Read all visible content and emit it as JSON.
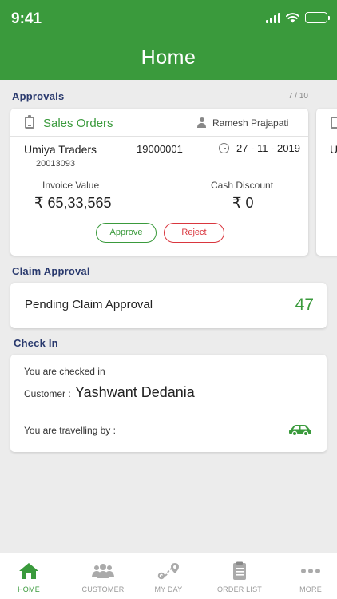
{
  "status_bar": {
    "time": "9:41"
  },
  "header": {
    "title": "Home"
  },
  "approvals": {
    "section_title": "Approvals",
    "pager": "7 / 10",
    "card": {
      "title": "Sales Orders",
      "person": "Ramesh Prajapati",
      "customer": "Umiya Traders",
      "customer_code": "20013093",
      "order_number": "19000001",
      "date": "27 - 11 - 2019",
      "invoice_label": "Invoice Value",
      "invoice_value": "₹ 65,33,565",
      "discount_label": "Cash Discount",
      "discount_value": "₹ 0",
      "approve_label": "Approve",
      "reject_label": "Reject"
    },
    "next_card_peek": "U"
  },
  "claim_approval": {
    "section_title": "Claim Approval",
    "label": "Pending Claim Approval",
    "count": "47"
  },
  "check_in": {
    "section_title": "Check In",
    "checked_in_text": "You are checked in",
    "customer_label": "Customer :",
    "customer_name": "Yashwant Dedania",
    "travel_text": "You are travelling by :",
    "travel_icon": "car-icon"
  },
  "bottom_nav": {
    "items": [
      {
        "label": "HOME",
        "icon": "home-icon",
        "active": true
      },
      {
        "label": "CUSTOMER",
        "icon": "customers-icon",
        "active": false
      },
      {
        "label": "MY DAY",
        "icon": "route-icon",
        "active": false
      },
      {
        "label": "ORDER LIST",
        "icon": "clipboard-icon",
        "active": false
      },
      {
        "label": "MORE",
        "icon": "more-dots-icon",
        "active": false
      }
    ]
  },
  "colors": {
    "brand_green": "#3a9a3c",
    "reject_red": "#d9363e",
    "section_title": "#2a3a6e",
    "background": "#ececec"
  }
}
